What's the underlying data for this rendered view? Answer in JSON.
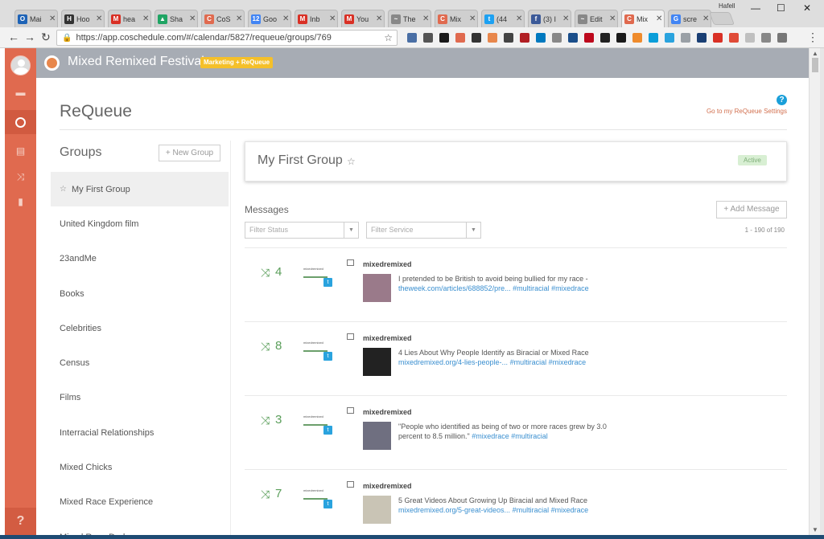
{
  "browser": {
    "tabs": [
      {
        "label": "Mai",
        "color": "#1e63b6",
        "glyph": "O"
      },
      {
        "label": "Hoo",
        "color": "#333333",
        "glyph": "H"
      },
      {
        "label": "hea",
        "color": "#d93025",
        "glyph": "M"
      },
      {
        "label": "Sha",
        "color": "#1fa463",
        "glyph": "▲"
      },
      {
        "label": "CoS",
        "color": "#e06a4f",
        "glyph": "C"
      },
      {
        "label": "Goo",
        "color": "#4285f4",
        "glyph": "12"
      },
      {
        "label": "Inb",
        "color": "#d93025",
        "glyph": "M"
      },
      {
        "label": "You",
        "color": "#d93025",
        "glyph": "M"
      },
      {
        "label": "The",
        "color": "#888888",
        "glyph": "~"
      },
      {
        "label": "Mix",
        "color": "#e06a4f",
        "glyph": "C"
      },
      {
        "label": "(44",
        "color": "#1da1f2",
        "glyph": "t"
      },
      {
        "label": "(3) I",
        "color": "#3b5998",
        "glyph": "f"
      },
      {
        "label": "Edit",
        "color": "#888888",
        "glyph": "~"
      },
      {
        "label": "Mix",
        "color": "#e06a4f",
        "glyph": "C",
        "active": true
      },
      {
        "label": "scre",
        "color": "#4285f4",
        "glyph": "G"
      }
    ],
    "user": "Hafell",
    "url": "https://app.coschedule.com/#/calendar/5827/requeue/groups/769",
    "extensions": [
      "#4a6fa5",
      "#555555",
      "#1a1a1a",
      "#e06a4f",
      "#333333",
      "#e8874c",
      "#444444",
      "#b11f24",
      "#0079bf",
      "#888888",
      "#1a4e8a",
      "#bd081c",
      "#222222",
      "#1a1a1a",
      "#ef8b2c",
      "#0a9ed9",
      "#2aa3de",
      "#9aa0a6",
      "#1a3f74",
      "#d93025",
      "#e04b37",
      "#c0c0c0",
      "#888888",
      "#777777"
    ]
  },
  "rail": {
    "items": [
      "briefcase-icon",
      "calendar-icon",
      "list-icon",
      "shuffle-icon",
      "analytics-icon"
    ],
    "help": "?"
  },
  "header": {
    "title": "Mixed Remixed Festival",
    "badge": "Marketing + ReQueue"
  },
  "page": {
    "title": "ReQueue",
    "help_glyph": "?",
    "settings_link": "Go to my ReQueue Settings"
  },
  "groups": {
    "heading": "Groups",
    "new_button": "+ New Group",
    "items": [
      "My First Group",
      "United Kingdom film",
      "23andMe",
      "Books",
      "Celebrities",
      "Census",
      "Films",
      "Interracial Relationships",
      "Mixed Chicks",
      "Mixed Race Experience",
      "Mixed Race Dads"
    ]
  },
  "group_card": {
    "name": "My First Group",
    "status": "Active"
  },
  "messages": {
    "heading": "Messages",
    "add_button": "+ Add Message",
    "filter_status": "Filter Status",
    "filter_service": "Filter Service",
    "count": "1 - 190 of 190",
    "items": [
      {
        "num": "4",
        "handle": "mixedremixed",
        "text": "I pretended to be British to avoid being bullied for my race -",
        "link": "theweek.com/articles/688852/pre...",
        "tags": "#multiracial #mixedrace",
        "thumb_color": "#9a7a8a"
      },
      {
        "num": "8",
        "handle": "mixedremixed",
        "text": "4 Lies About Why People Identify as Biracial or Mixed Race",
        "link": "mixedremixed.org/4-lies-people-...",
        "tags": "#multiracial #mixedrace",
        "thumb_color": "#222222"
      },
      {
        "num": "3",
        "handle": "mixedremixed",
        "text": "\"People who identified as being of two or more races grew by 3.0 percent to 8.5 million.\"",
        "link": "",
        "tags": "#mixedrace #multiracial",
        "thumb_color": "#6f6f80"
      },
      {
        "num": "7",
        "handle": "mixedremixed",
        "text": "5 Great Videos About Growing Up Biracial and Mixed Race",
        "link": "mixedremixed.org/5-great-videos...",
        "tags": "#multiracial #mixedrace",
        "thumb_color": "#c9c4b5"
      }
    ],
    "brand_text": "mixedremixed"
  },
  "colors": {
    "accent": "#e06a4f",
    "header": "#a7acb4",
    "badge": "#f5c02a",
    "twitter": "#2aa3de",
    "requeue_green": "#5a9e5a"
  }
}
